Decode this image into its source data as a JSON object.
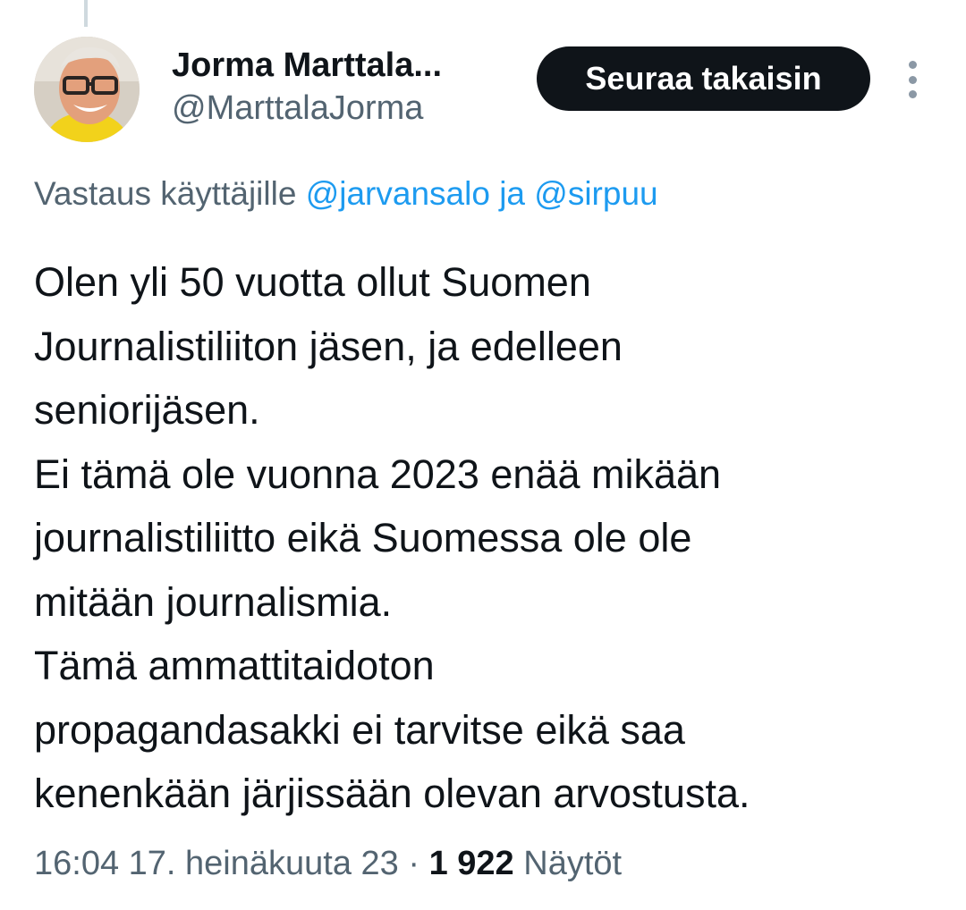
{
  "author": {
    "display_name": "Jorma Marttala...",
    "handle": "@MarttalaJorma"
  },
  "follow_button": {
    "label": "Seuraa takaisin"
  },
  "more_menu": {
    "icon": "more-vertical-icon"
  },
  "reply_context": {
    "prefix": "Vastaus käyttäjille",
    "mention_1": "@jarvansalo",
    "joiner": "ja",
    "mention_2": "@sirpuu"
  },
  "tweet": {
    "lines": [
      "Olen yli 50 vuotta ollut Suomen",
      "Journalistiliiton jäsen, ja edelleen",
      "seniorijäsen.",
      "Ei tämä ole vuonna 2023 enää mikään",
      "journalistiliitto eikä Suomessa ole ole",
      "mitään journalismia.",
      "Tämä ammattitaidoton",
      "propagandasakki ei tarvitse eikä saa",
      "kenenkään järjissään olevan arvostusta."
    ]
  },
  "meta": {
    "time": "16:04",
    "date": "17. heinäkuuta 23",
    "separator": "·",
    "views_count": "1 922",
    "views_label": "Näytöt"
  },
  "colors": {
    "text_primary": "#0f1419",
    "text_secondary": "#536471",
    "link": "#1d9bf0",
    "button_bg": "#0f1419",
    "button_text": "#ffffff"
  }
}
